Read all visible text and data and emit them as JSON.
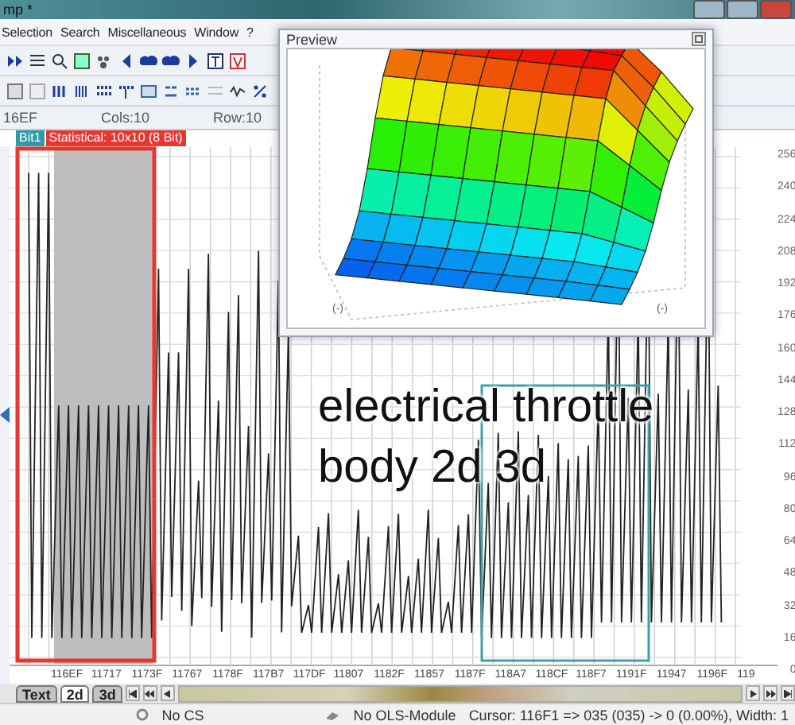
{
  "window": {
    "title": "mp *"
  },
  "menu": [
    {
      "label": "Selection"
    },
    {
      "label": "Search"
    },
    {
      "label": "Miscellaneous"
    },
    {
      "label": "Window"
    },
    {
      "label": "?"
    }
  ],
  "map_info": {
    "address": "16EF",
    "cols": "Cols:10",
    "rows": "Row:10"
  },
  "map_tabs": [
    {
      "label": "Bit1",
      "kind": "bit"
    },
    {
      "label": "Statistical: 10x10 (8 Bit)",
      "kind": "map"
    }
  ],
  "graph": {
    "y_labels": [
      "256",
      "240",
      "224",
      "208",
      "192",
      "176",
      "160",
      "144",
      "128",
      "112",
      "96",
      "80",
      "64",
      "48",
      "32",
      "16",
      "0"
    ],
    "x_labels": [
      "116EF",
      "11717",
      "1173F",
      "11767",
      "1178F",
      "117B7",
      "117DF",
      "11807",
      "1182F",
      "11857",
      "1187F",
      "118A7",
      "118CF",
      "118F7",
      "1191F",
      "11947",
      "1196F",
      "119"
    ]
  },
  "view_tabs": [
    {
      "label": "Text",
      "selected": false
    },
    {
      "label": "2d",
      "selected": true
    },
    {
      "label": "3d",
      "selected": false
    }
  ],
  "status_bar": {
    "checksum": "No CS",
    "module": "No OLS-Module",
    "cursor": "Cursor: 116F1 => 035 (035) -> 0 (0.00%), Width: 1"
  },
  "preview": {
    "title": "Preview",
    "axis_labels": [
      "(-)",
      "(-)"
    ]
  },
  "caption": [
    "electrical throttle",
    "body  2d  3d"
  ]
}
